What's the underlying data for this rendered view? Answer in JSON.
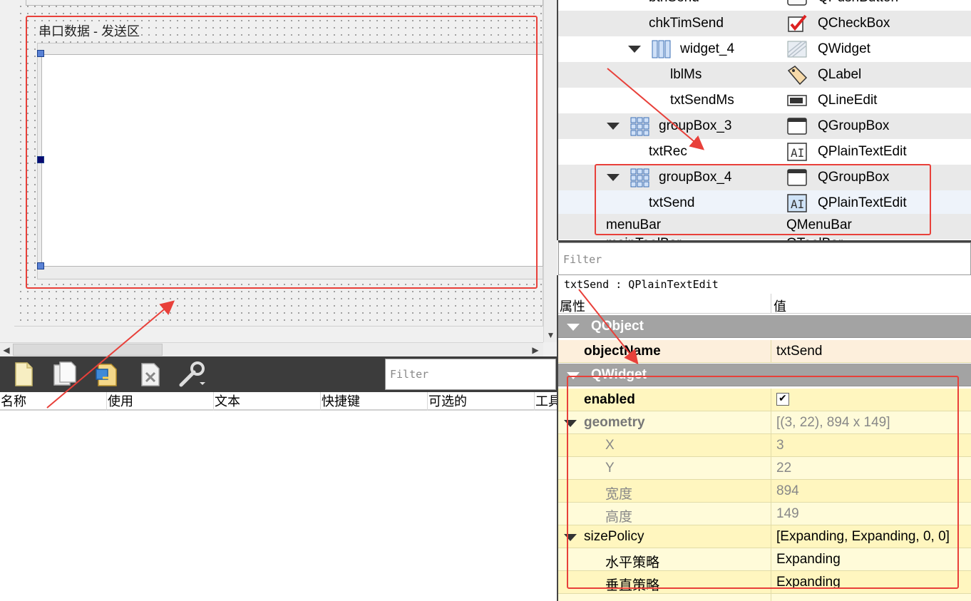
{
  "designer": {
    "groupbox_title": "串口数据 - 发送区"
  },
  "action_editor": {
    "filter_placeholder": "Filter",
    "columns": [
      "名称",
      "使用",
      "文本",
      "快捷键",
      "可选的",
      "工具"
    ]
  },
  "object_inspector": {
    "rows": [
      {
        "name": "btnSend",
        "class": "QPushButton"
      },
      {
        "name": "chkTimSend",
        "class": "QCheckBox"
      },
      {
        "name": "widget_4",
        "class": "QWidget"
      },
      {
        "name": "lblMs",
        "class": "QLabel"
      },
      {
        "name": "txtSendMs",
        "class": "QLineEdit"
      },
      {
        "name": "groupBox_3",
        "class": "QGroupBox"
      },
      {
        "name": "txtRec",
        "class": "QPlainTextEdit"
      },
      {
        "name": "groupBox_4",
        "class": "QGroupBox"
      },
      {
        "name": "txtSend",
        "class": "QPlainTextEdit"
      },
      {
        "name": "menuBar",
        "class": "QMenuBar"
      },
      {
        "name": "mainToolBar",
        "class": "QToolBar"
      }
    ],
    "filter_placeholder": "Filter"
  },
  "property_editor": {
    "title": "txtSend : QPlainTextEdit",
    "col_property": "属性",
    "col_value": "值",
    "groups": {
      "qobject": "QObject",
      "qwidget": "QWidget"
    },
    "props": {
      "objectName": {
        "name": "objectName",
        "value": "txtSend"
      },
      "enabled": {
        "name": "enabled",
        "value": "✔"
      },
      "geometry": {
        "name": "geometry",
        "value": "[(3, 22), 894 x 149]"
      },
      "x": {
        "name": "X",
        "value": "3"
      },
      "y": {
        "name": "Y",
        "value": "22"
      },
      "width": {
        "name": "宽度",
        "value": "894"
      },
      "height": {
        "name": "高度",
        "value": "149"
      },
      "sizePolicy": {
        "name": "sizePolicy",
        "value": "[Expanding, Expanding, 0, 0]"
      },
      "hPolicy": {
        "name": "水平策略",
        "value": "Expanding"
      },
      "vPolicy": {
        "name": "垂直策略",
        "value": "Expanding"
      }
    }
  },
  "colors": {
    "annotation_red": "#e8403a",
    "group_header": "#a3a3a3",
    "property_yellow": "#fff6bf"
  }
}
